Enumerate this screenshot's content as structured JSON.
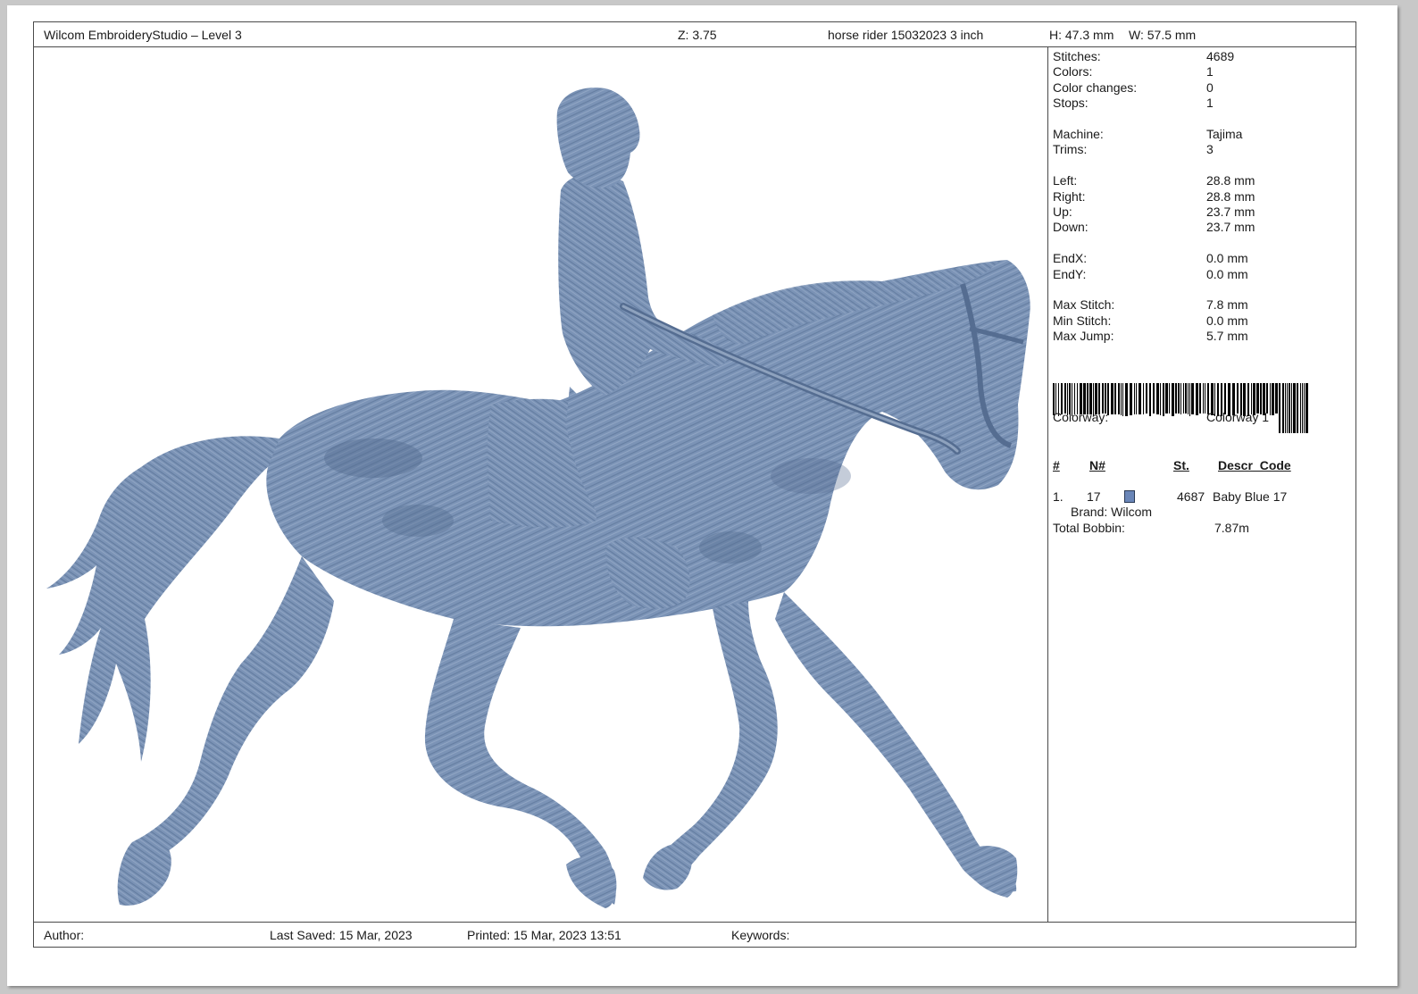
{
  "header": {
    "app_title": "Wilcom EmbroideryStudio – Level 3",
    "zoom": "Z: 3.75",
    "design_name": "horse rider 15032023 3 inch",
    "height": "H: 47.3 mm",
    "width": "W: 57.5 mm"
  },
  "stats": [
    {
      "label": "Stitches:",
      "value": "4689"
    },
    {
      "label": "Colors:",
      "value": "1"
    },
    {
      "label": "Color changes:",
      "value": "0"
    },
    {
      "label": "Stops:",
      "value": "1"
    },
    {
      "label": "Machine:",
      "value": "Tajima"
    },
    {
      "label": "Trims:",
      "value": "3"
    },
    {
      "label": "Left:",
      "value": "28.8 mm"
    },
    {
      "label": "Right:",
      "value": "28.8 mm"
    },
    {
      "label": "Up:",
      "value": "23.7 mm"
    },
    {
      "label": "Down:",
      "value": "23.7 mm"
    },
    {
      "label": "EndX:",
      "value": "0.0 mm"
    },
    {
      "label": "EndY:",
      "value": "0.0 mm"
    },
    {
      "label": "Max Stitch:",
      "value": "7.8 mm"
    },
    {
      "label": "Min Stitch:",
      "value": "0.0 mm"
    },
    {
      "label": "Max Jump:",
      "value": "5.7 mm"
    }
  ],
  "colorway": {
    "label": "Colorway:",
    "value": "Colorway 1"
  },
  "color_table": {
    "headers": {
      "num": "#",
      "n_num": "N#",
      "st": "St.",
      "descr": "Descr_Code"
    },
    "rows": [
      {
        "index": "1.",
        "n": "17",
        "st": "4687",
        "descr": "Baby Blue 17",
        "brand": "Brand: Wilcom",
        "swatch_color": "#6a86b8"
      }
    ]
  },
  "total_bobbin": {
    "label": "Total Bobbin:",
    "value": "7.87m"
  },
  "footer": {
    "author": "Author:",
    "last_saved": "Last Saved: 15 Mar, 2023",
    "printed": "Printed: 15 Mar, 2023 13:51",
    "keywords": "Keywords:"
  },
  "design": {
    "thread_color": "#7b93b6",
    "shade_color": "#556d91",
    "highlight_color": "#a7b9d2"
  }
}
